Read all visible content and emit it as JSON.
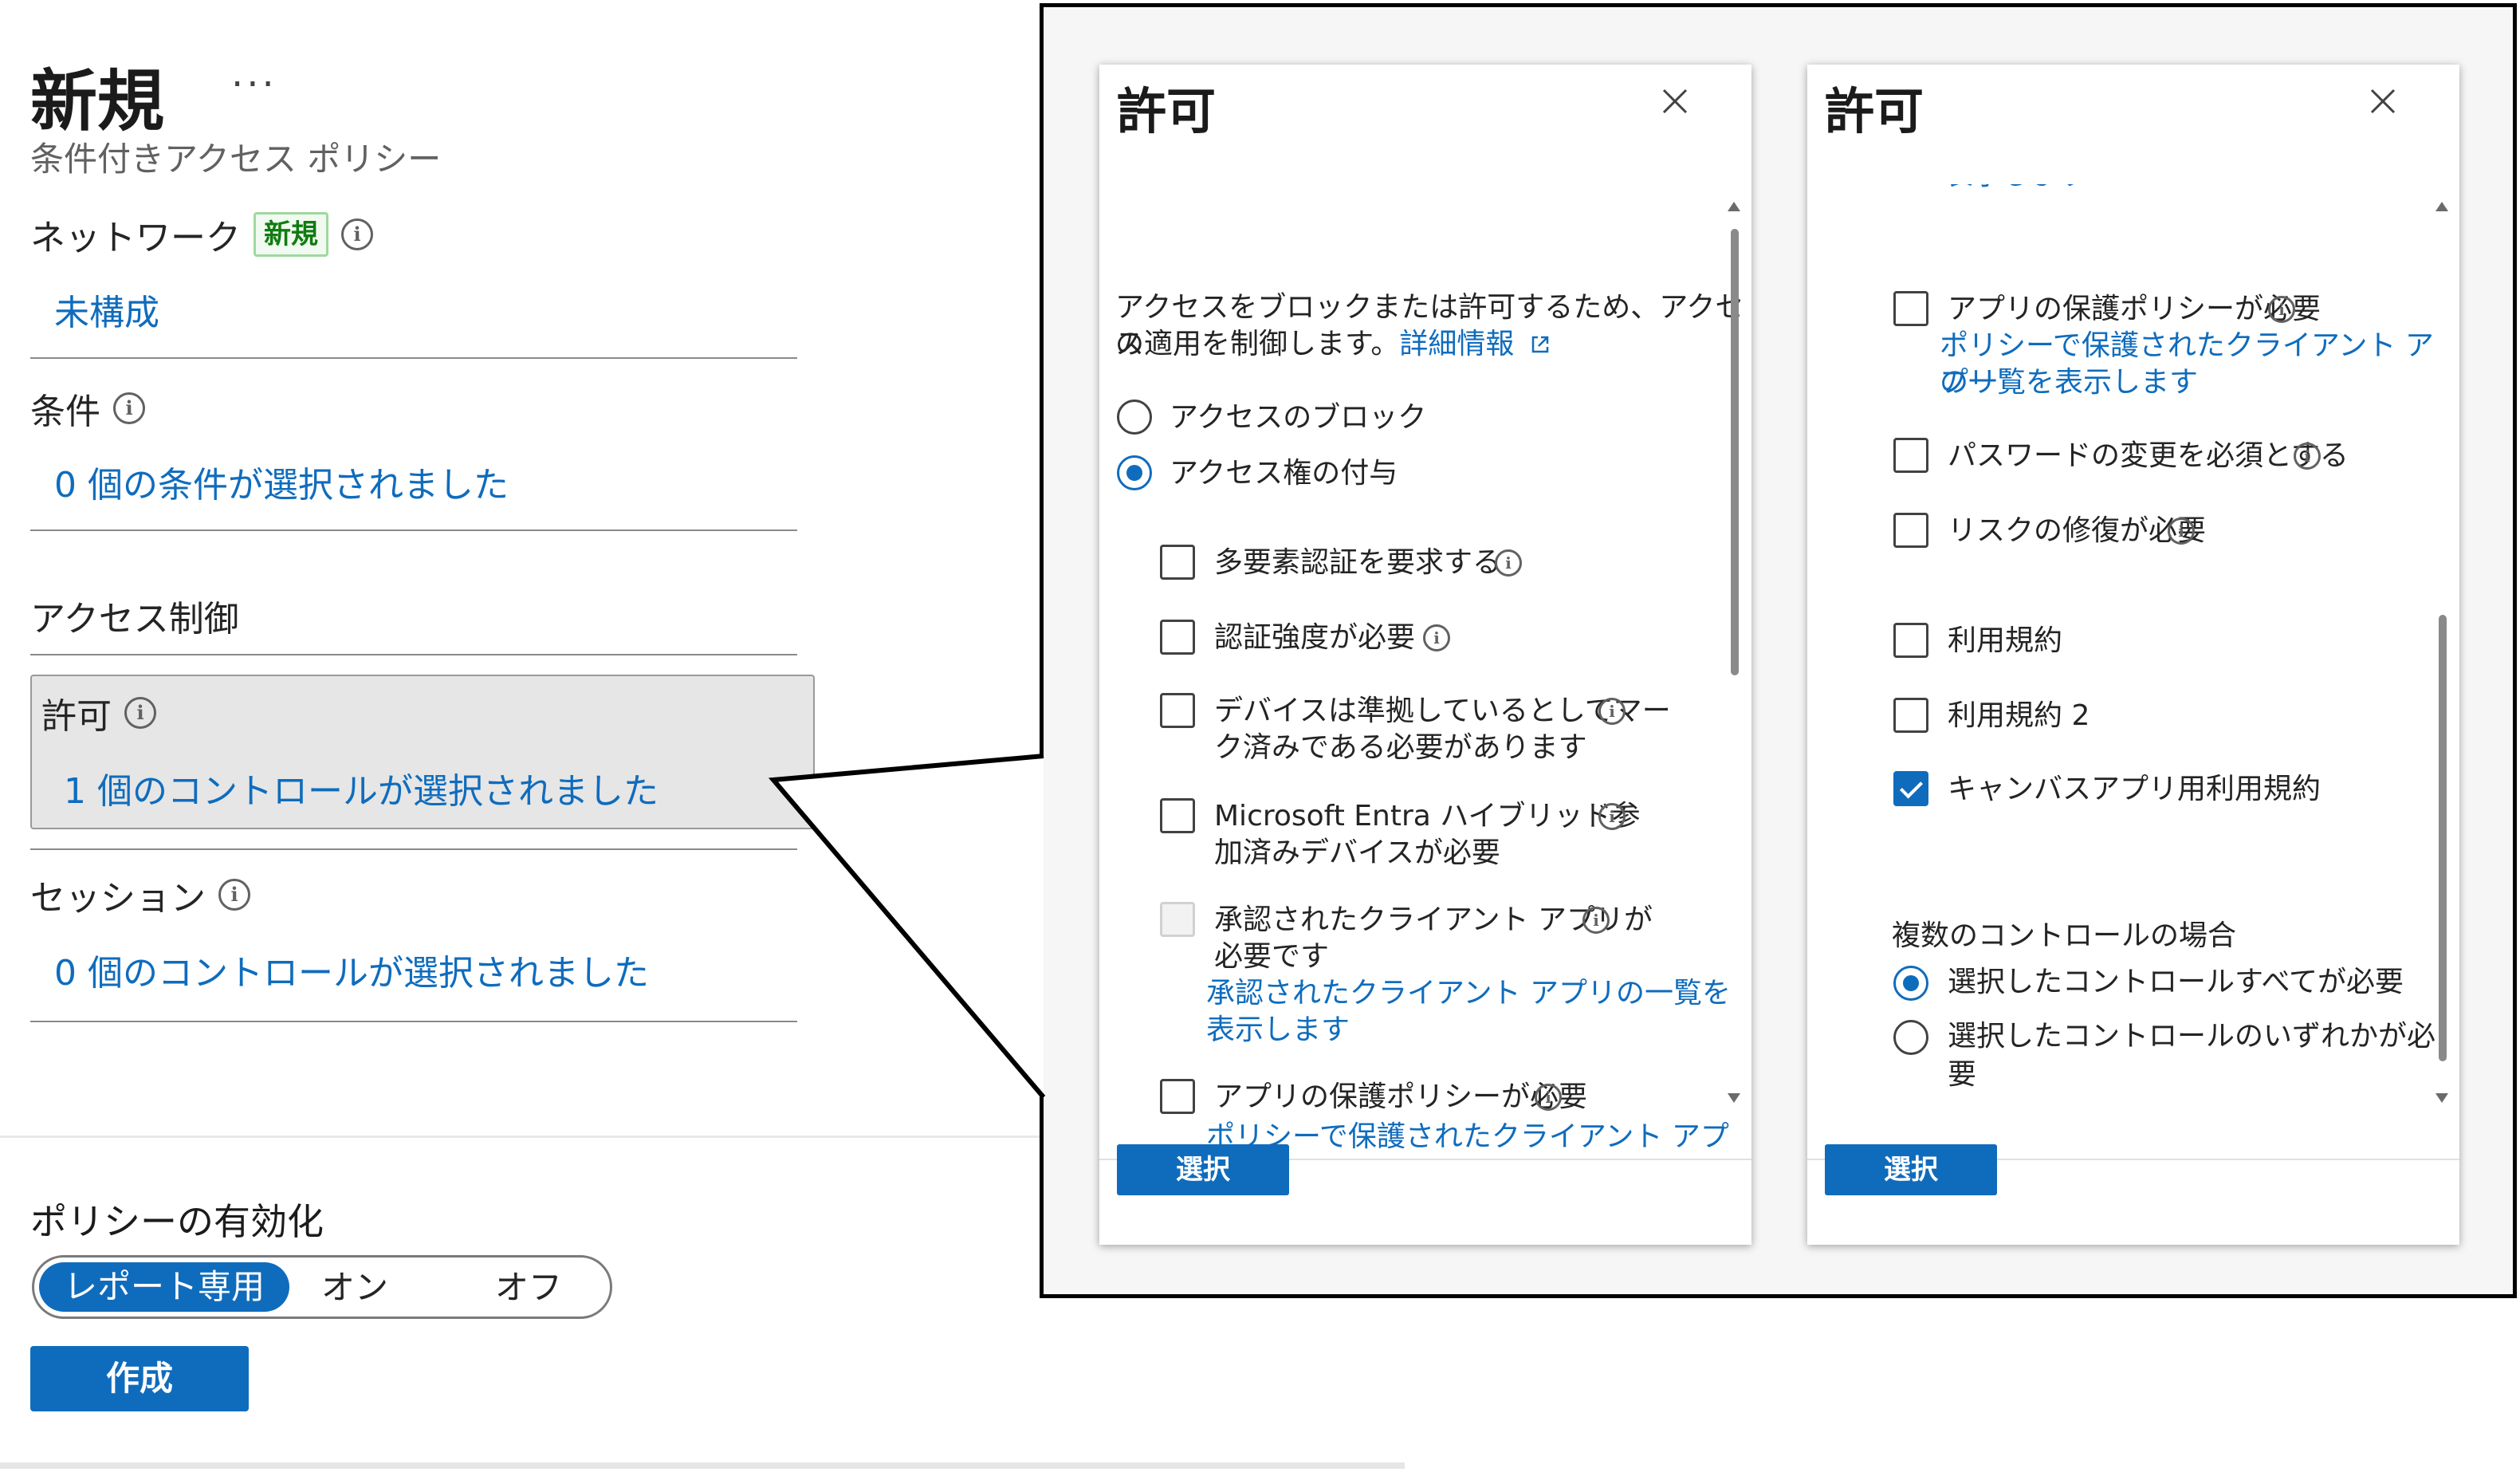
{
  "blade": {
    "title": "新規",
    "more": "···",
    "subtitle": "条件付きアクセス ポリシー",
    "network": {
      "label": "ネットワーク",
      "badge": "新規",
      "value": "未構成"
    },
    "conditions": {
      "label": "条件",
      "value": "0 個の条件が選択されました"
    },
    "access_controls": {
      "heading": "アクセス制御"
    },
    "grant": {
      "label": "許可",
      "value": "1 個のコントロールが選択されました"
    },
    "session": {
      "label": "セッション",
      "value": "0 個のコントロールが選択されました"
    },
    "enable_policy": {
      "label": "ポリシーの有効化",
      "options": [
        "レポート専用",
        "オン",
        "オフ"
      ],
      "selected": "レポート専用"
    },
    "create_button": "作成"
  },
  "panel_left": {
    "title": "許可",
    "description_1": "アクセスをブロックまたは許可するため、アクセス",
    "description_2": "の適用を制御します。",
    "learn_more": "詳細情報",
    "radio_block": "アクセスのブロック",
    "radio_grant": "アクセス権の付与",
    "options": {
      "mfa": "多要素認証を要求する",
      "auth_strength": "認証強度が必要",
      "compliant_1": "デバイスは準拠しているとしてマー",
      "compliant_2": "ク済みである必要があります",
      "hybrid_1": "Microsoft Entra ハイブリッド参",
      "hybrid_2": "加済みデバイスが必要",
      "approved_1": "承認されたクライアント アプリが",
      "approved_2": "必要です",
      "approved_link_1": "承認されたクライアント アプリの一覧を",
      "approved_link_2": "表示します",
      "app_protection": "アプリの保護ポリシーが必要",
      "app_protection_link": "ポリシーで保護されたクライアント アプリ"
    },
    "select_button": "選択"
  },
  "panel_right": {
    "title": "許可",
    "clipped_text": "表示します",
    "options": {
      "app_protection": "アプリの保護ポリシーが必要",
      "app_protection_link_1": "ポリシーで保護されたクライアント アプリ",
      "app_protection_link_2": "の一覧を表示します",
      "password_change": "パスワードの変更を必須とする",
      "risk_remediation": "リスクの修復が必要",
      "terms_of_use": "利用規約",
      "terms_of_use_2": "利用規約 2",
      "canvas_terms": "キャンバスアプリ用利用規約"
    },
    "multiple_controls": {
      "heading": "複数のコントロールの場合",
      "require_all": "選択したコントロールすべてが必要",
      "require_one_1": "選択したコントロールのいずれかが必",
      "require_one_2": "要"
    },
    "select_button": "選択"
  },
  "colors": {
    "accent": "#0f6cbd",
    "badge_text": "#107c10",
    "badge_bg": "#f1faf1"
  },
  "icons": [
    "ellipsis-icon",
    "info-icon",
    "close-icon",
    "external-link-icon",
    "scroll-up-icon",
    "scroll-down-icon"
  ]
}
